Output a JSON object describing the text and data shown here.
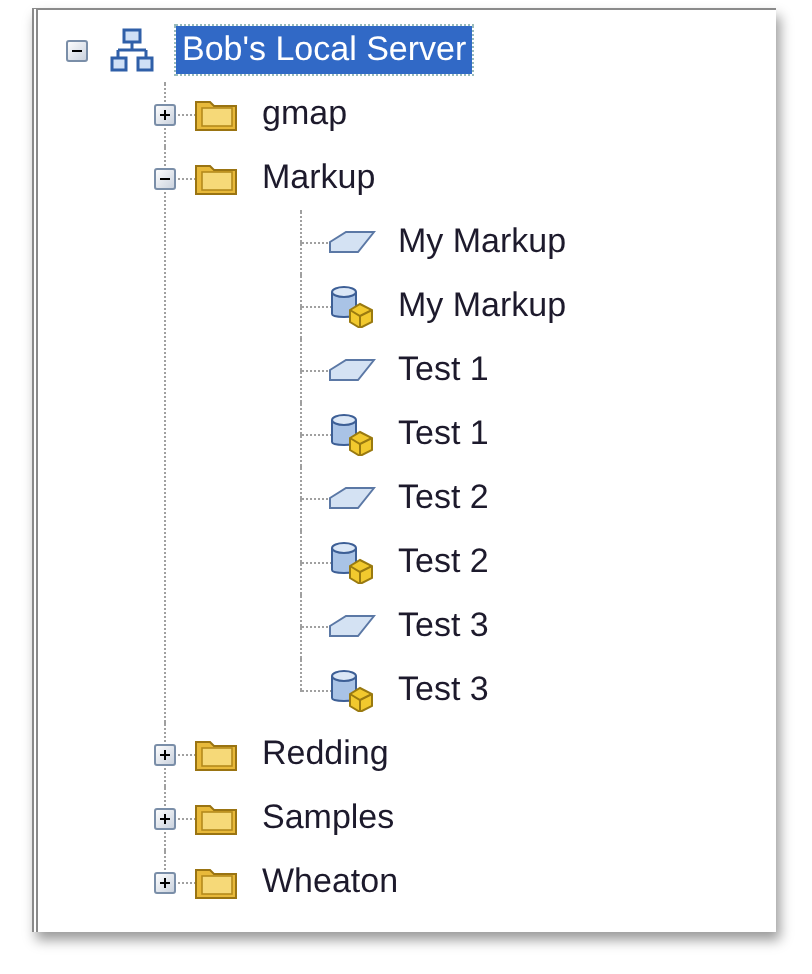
{
  "tree": {
    "label": "Bob's Local Server",
    "kind": "server",
    "selected": true,
    "expanded": true,
    "children": [
      {
        "label": "gmap",
        "kind": "folder",
        "selected": false,
        "expanded": false
      },
      {
        "label": "Markup",
        "kind": "folder",
        "selected": false,
        "expanded": true,
        "children": [
          {
            "label": "My Markup",
            "kind": "view",
            "selected": false
          },
          {
            "label": "My Markup",
            "kind": "database",
            "selected": false
          },
          {
            "label": "Test 1",
            "kind": "view",
            "selected": false
          },
          {
            "label": "Test 1",
            "kind": "database",
            "selected": false
          },
          {
            "label": "Test 2",
            "kind": "view",
            "selected": false
          },
          {
            "label": "Test 2",
            "kind": "database",
            "selected": false
          },
          {
            "label": "Test 3",
            "kind": "view",
            "selected": false
          },
          {
            "label": "Test 3",
            "kind": "database",
            "selected": false
          }
        ]
      },
      {
        "label": "Redding",
        "kind": "folder",
        "selected": false,
        "expanded": false
      },
      {
        "label": "Samples",
        "kind": "folder",
        "selected": false,
        "expanded": false
      },
      {
        "label": "Wheaton",
        "kind": "folder",
        "selected": false,
        "expanded": false
      }
    ]
  }
}
